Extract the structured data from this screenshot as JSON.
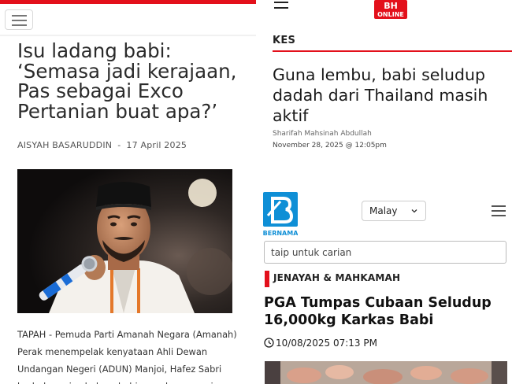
{
  "left": {
    "title": "Isu ladang babi: ‘Semasa jadi kerajaan, Pas sebagai Exco Pertanian buat apa?’",
    "author": "AISYAH BASARUDDIN",
    "separator": "-",
    "date": "17 April 2025",
    "body": "TAPAH - Pemuda Parti Amanah Negara (Amanah) Perak menempelak kenyataan Ahli Dewan Undangan Negeri (ADUN) Manjoi, Hafez Sabri berhubung isu ladang babi yang beroperasi secara",
    "menu_icon": "hamburger-icon",
    "accent": "#e3101b"
  },
  "top_right": {
    "logo_text": "BH",
    "logo_sub": "ONLINE",
    "section": "KES",
    "title": "Guna lembu, babi seludup dadah dari Thailand masih aktif",
    "author": "Sharifah Mahsinah Abdullah",
    "date": "November 28, 2025 @ 12:05pm",
    "menu_icon": "hamburger-icon",
    "accent": "#e3101b"
  },
  "bottom_right": {
    "logo_text": "BERNAMA",
    "language": "Malay",
    "search_placeholder": "taip untuk carian",
    "category": "JENAYAH & MAHKAMAH",
    "title": "PGA Tumpas Cubaan Seludup 16,000kg Karkas Babi",
    "datetime": "10/08/2025 07:13 PM",
    "menu_icon": "hamburger-icon",
    "brand_color": "#0f8fd6",
    "accent": "#e3101b"
  }
}
